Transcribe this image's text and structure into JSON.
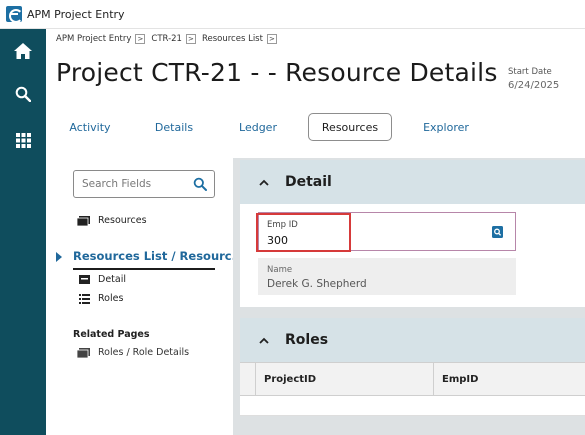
{
  "window": {
    "title": "APM Project Entry"
  },
  "rail": {
    "items": [
      "home-icon",
      "search-icon",
      "apps-grid-icon"
    ]
  },
  "breadcrumb": {
    "items": [
      "APM Project Entry",
      "CTR-21",
      "Resources List"
    ],
    "separator": ">"
  },
  "header": {
    "title": "Project CTR-21 - - Resource Details",
    "start_date_label": "Start Date",
    "start_date_value": "6/24/2025"
  },
  "tabs": [
    {
      "label": "Activity",
      "active": false
    },
    {
      "label": "Details",
      "active": false
    },
    {
      "label": "Ledger",
      "active": false
    },
    {
      "label": "Resources",
      "active": true
    },
    {
      "label": "Explorer",
      "active": false
    }
  ],
  "sidebar": {
    "search_placeholder": "Search Fields",
    "items": [
      {
        "label": "Resources",
        "icon": "card-icon"
      },
      {
        "label": "Resources List / Resourc...",
        "active": true
      },
      {
        "label": "Detail",
        "icon": "form-icon"
      },
      {
        "label": "Roles",
        "icon": "list-icon"
      }
    ],
    "related_title": "Related Pages",
    "related_items": [
      {
        "label": "Roles / Role Details",
        "icon": "card-icon"
      }
    ]
  },
  "detail": {
    "title": "Detail",
    "emp_id_label": "Emp ID",
    "emp_id_value": "300",
    "name_label": "Name",
    "name_value": "Derek G. Shepherd"
  },
  "roles": {
    "title": "Roles",
    "columns": [
      "ProjectID",
      "EmpID"
    ]
  },
  "colors": {
    "rail": "#0f4d5d",
    "accent": "#20689b",
    "section_header": "#d6e2e7",
    "highlight": "#d63a3a"
  }
}
